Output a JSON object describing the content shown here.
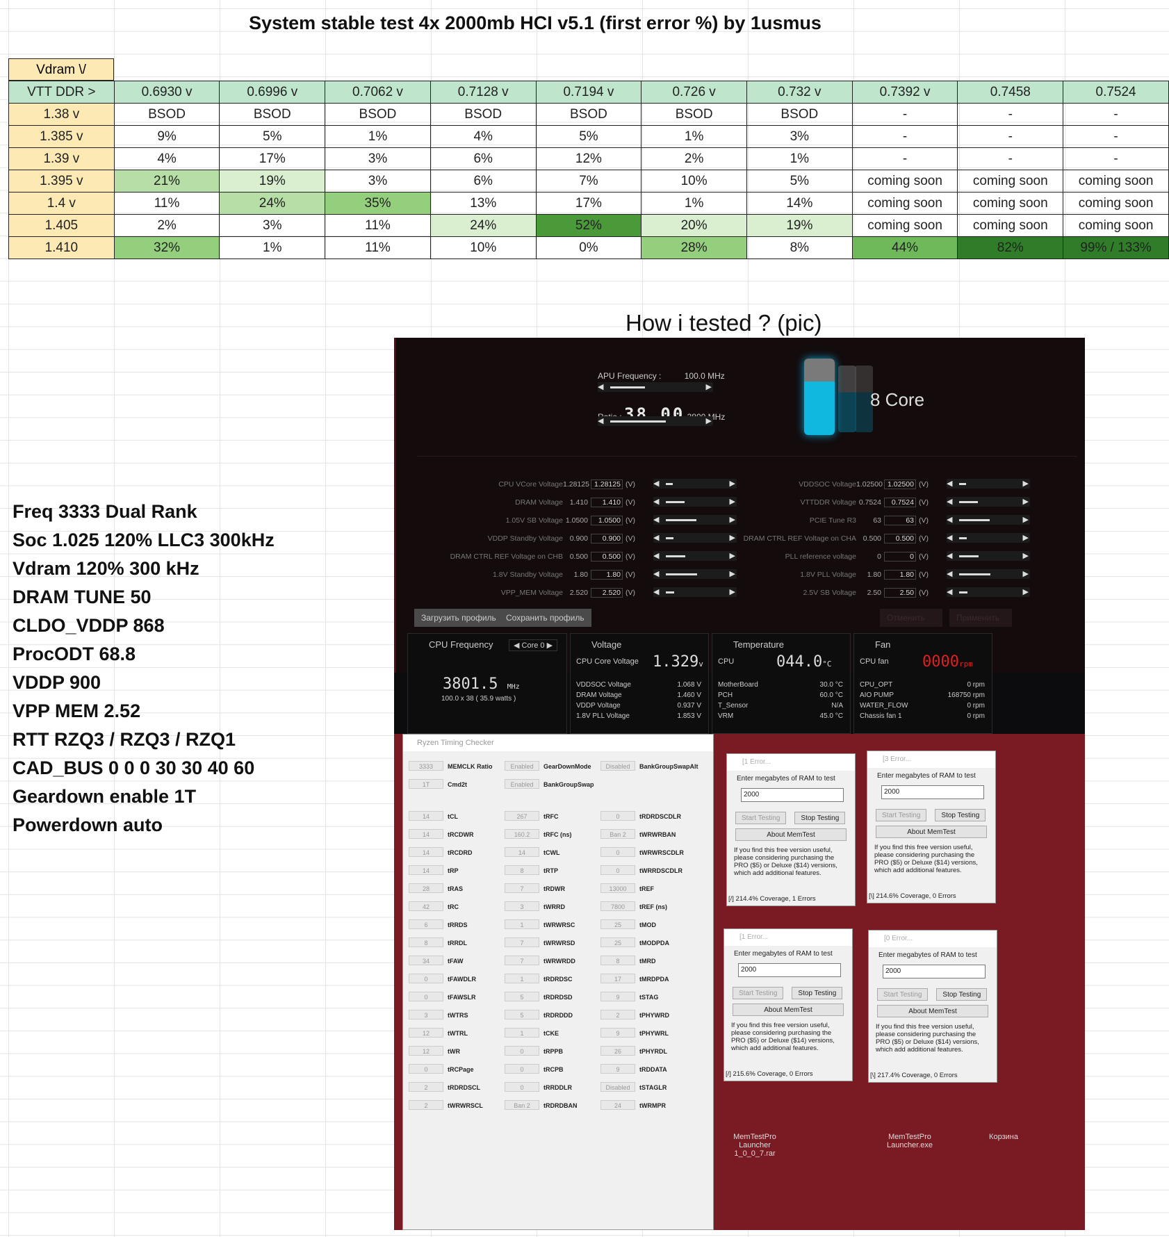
{
  "title": "System stable test 4x 2000mb HCI v5.1 (first error %) by 1usmus",
  "vdram_label": "Vdram \\/",
  "header_row": [
    "VTT DDR  >",
    "0.6930 v",
    "0.6996 v",
    "0.7062 v",
    "0.7128 v",
    "0.7194 v",
    "0.726 v",
    "0.732 v",
    "0.7392 v",
    "0.7458",
    "0.7524"
  ],
  "rows": [
    [
      "1.38 v",
      "BSOD",
      "BSOD",
      "BSOD",
      "BSOD",
      "BSOD",
      "BSOD",
      "BSOD",
      "-",
      "-",
      "-"
    ],
    [
      "1.385 v",
      "9%",
      "5%",
      "1%",
      "4%",
      "5%",
      "1%",
      "3%",
      "-",
      "-",
      "-"
    ],
    [
      "1.39 v",
      "4%",
      "17%",
      "3%",
      "6%",
      "12%",
      "2%",
      "1%",
      "-",
      "-",
      "-"
    ],
    [
      "1.395 v",
      "21%",
      "19%",
      "3%",
      "6%",
      "7%",
      "10%",
      "5%",
      "coming soon",
      "coming soon",
      "coming soon"
    ],
    [
      "1.4 v",
      "11%",
      "24%",
      "35%",
      "13%",
      "17%",
      "1%",
      "14%",
      "coming soon",
      "coming soon",
      "coming soon"
    ],
    [
      "1.405",
      "2%",
      "3%",
      "11%",
      "24%",
      "52%",
      "20%",
      "19%",
      "coming soon",
      "coming soon",
      "coming soon"
    ],
    [
      "1.410",
      "32%",
      "1%",
      "11%",
      "10%",
      "0%",
      "28%",
      "8%",
      "44%",
      "82%",
      "99% / 133%"
    ]
  ],
  "how_tested": "How i tested ? (pic)",
  "notes": [
    "Freq 3333 Dual Rank",
    "Soc 1.025 120% LLC3 300kHz",
    "Vdram 120% 300 kHz",
    "DRAM TUNE 50",
    "CLDO_VDDP 868",
    "ProcODT 68.8",
    "VDDP 900",
    "VPP MEM 2.52",
    "RTT RZQ3 / RZQ3 / RZQ1",
    "CAD_BUS 0 0 0 30 30 40 60",
    "Geardown enable 1T",
    "Powerdown auto"
  ],
  "ryzen_master": {
    "apu_label": "APU Frequency :",
    "apu_value": "100.0  MHz",
    "ratio_label": "Ratio :",
    "ratio_value": "38.00",
    "ratio_mhz": "3800 MHz",
    "cores": "8 Core",
    "left_volts": [
      [
        "CPU VCore Voltage",
        "1.28125",
        "1.28125"
      ],
      [
        "DRAM Voltage",
        "1.410",
        "1.410"
      ],
      [
        "1.05V SB Voltage",
        "1.0500",
        "1.0500"
      ],
      [
        "VDDP Standby Voltage",
        "0.900",
        "0.900"
      ],
      [
        "DRAM CTRL REF Voltage on CHB",
        "0.500",
        "0.500"
      ],
      [
        "1.8V Standby Voltage",
        "1.80",
        "1.80"
      ],
      [
        "VPP_MEM Voltage",
        "2.520",
        "2.520"
      ]
    ],
    "right_volts": [
      [
        "VDDSOC Voltage",
        "1.02500",
        "1.02500"
      ],
      [
        "VTTDDR Voltage",
        "0.7524",
        "0.7524"
      ],
      [
        "PCIE Tune R3",
        "63",
        "63"
      ],
      [
        "DRAM CTRL REF Voltage on CHA",
        "0.500",
        "0.500"
      ],
      [
        "PLL reference voltage",
        "0",
        "0"
      ],
      [
        "1.8V PLL Voltage",
        "1.80",
        "1.80"
      ],
      [
        "2.5V SB Voltage",
        "2.50",
        "2.50"
      ]
    ],
    "unit": "(V)",
    "load_profile": "Загрузить профиль",
    "save_profile": "Сохранить профиль",
    "cancel": "Отменить",
    "apply": "Применить",
    "cpu_freq_title": "CPU Frequency",
    "core_sel": "Core 0",
    "cpu_freq": "3801.5",
    "cpu_freq_unit": "MHz",
    "cpu_freq_sub": "100.0  x 38    ( 35.9 watts )",
    "voltage_title": "Voltage",
    "cpu_core_voltage_label": "CPU Core Voltage",
    "cpu_core_voltage": "1.329",
    "volt_unit": "v",
    "voltage_lines": [
      [
        "VDDSOC Voltage",
        "1.068  V"
      ],
      [
        "DRAM Voltage",
        "1.460  V"
      ],
      [
        "VDDP Voltage",
        "0.937  V"
      ],
      [
        "1.8V PLL Voltage",
        "1.853  V"
      ]
    ],
    "temp_title": "Temperature",
    "cpu_label": "CPU",
    "cpu_temp": "044.0",
    "temp_unit": "°C",
    "temp_lines": [
      [
        "MotherBoard",
        "30.0 °C"
      ],
      [
        "PCH",
        "60.0 °C"
      ],
      [
        "T_Sensor",
        "N/A"
      ],
      [
        "VRM",
        "45.0 °C"
      ]
    ],
    "fan_title": "Fan",
    "cpu_fan_label": "CPU fan",
    "cpu_fan": "0000",
    "fan_unit": "rpm",
    "fan_lines": [
      [
        "CPU_OPT",
        "0  rpm"
      ],
      [
        "AIO PUMP",
        "168750  rpm"
      ],
      [
        "WATER_FLOW",
        "0  rpm"
      ],
      [
        "Chassis fan 1",
        "0  rpm"
      ]
    ]
  },
  "rtc": {
    "title": "Ryzen Timing Checker",
    "rows": [
      [
        "3333",
        "MEMCLK Ratio",
        "Enabled",
        "GearDownMode",
        "Disabled",
        "BankGroupSwapAlt"
      ],
      [
        "1T",
        "Cmd2t",
        "Enabled",
        "BankGroupSwap",
        "",
        ""
      ],
      [
        "14",
        "tCL",
        "267",
        "tRFC",
        "0",
        "tRDRDSCDLR"
      ],
      [
        "14",
        "tRCDWR",
        "160.2",
        "tRFC (ns)",
        "Ban 2",
        "tWRWRBAN"
      ],
      [
        "14",
        "tRCDRD",
        "14",
        "tCWL",
        "0",
        "tWRWRSCDLR"
      ],
      [
        "14",
        "tRP",
        "8",
        "tRTP",
        "0",
        "tWRRDSCDLR"
      ],
      [
        "28",
        "tRAS",
        "7",
        "tRDWR",
        "13000",
        "tREF"
      ],
      [
        "42",
        "tRC",
        "3",
        "tWRRD",
        "7800",
        "tREF (ns)"
      ],
      [
        "6",
        "tRRDS",
        "1",
        "tWRWRSC",
        "25",
        "tMOD"
      ],
      [
        "8",
        "tRRDL",
        "7",
        "tWRWRSD",
        "25",
        "tMODPDA"
      ],
      [
        "34",
        "tFAW",
        "7",
        "tWRWRDD",
        "8",
        "tMRD"
      ],
      [
        "0",
        "tFAWDLR",
        "1",
        "tRDRDSC",
        "17",
        "tMRDPDA"
      ],
      [
        "0",
        "tFAWSLR",
        "5",
        "tRDRDSD",
        "9",
        "tSTAG"
      ],
      [
        "3",
        "tWTRS",
        "5",
        "tRDRDDD",
        "2",
        "tPHYWRD"
      ],
      [
        "12",
        "tWTRL",
        "1",
        "tCKE",
        "9",
        "tPHYWRL"
      ],
      [
        "12",
        "tWR",
        "0",
        "tRPPB",
        "26",
        "tPHYRDL"
      ],
      [
        "0",
        "tRCPage",
        "0",
        "tRCPB",
        "9",
        "tRDDATA"
      ],
      [
        "2",
        "tRDRDSCL",
        "0",
        "tRRDDLR",
        "Disabled",
        "tSTAGLR"
      ],
      [
        "2",
        "tWRWRSCL",
        "Ban 2",
        "tRDRDBAN",
        "24",
        "tWRMPR"
      ]
    ]
  },
  "memtest": [
    {
      "title": "[1 Error...",
      "status": "[/]  214.4% Coverage, 1 Errors"
    },
    {
      "title": "[3 Error...",
      "status": "[\\]  214.6% Coverage, 0 Errors"
    },
    {
      "title": "[1 Error...",
      "status": "[/]  215.6% Coverage, 0 Errors"
    },
    {
      "title": "[0 Error...",
      "status": "[\\]  217.4% Coverage, 0 Errors"
    }
  ],
  "mt_common": {
    "prompt": "Enter megabytes of RAM to test",
    "value": "2000",
    "start": "Start Testing",
    "stop": "Stop Testing",
    "about": "About MemTest",
    "msg": "If you find this free version useful, please considering purchasing the PRO ($5) or Deluxe ($14) versions, which add additional features."
  },
  "desktop": {
    "launcher": "MemTestPro Launcher",
    "launcher_file": "1_0_0_7.rar",
    "exe": "MemTestPro",
    "exe_file": "Launcher.exe",
    "trash": "Корзина"
  }
}
